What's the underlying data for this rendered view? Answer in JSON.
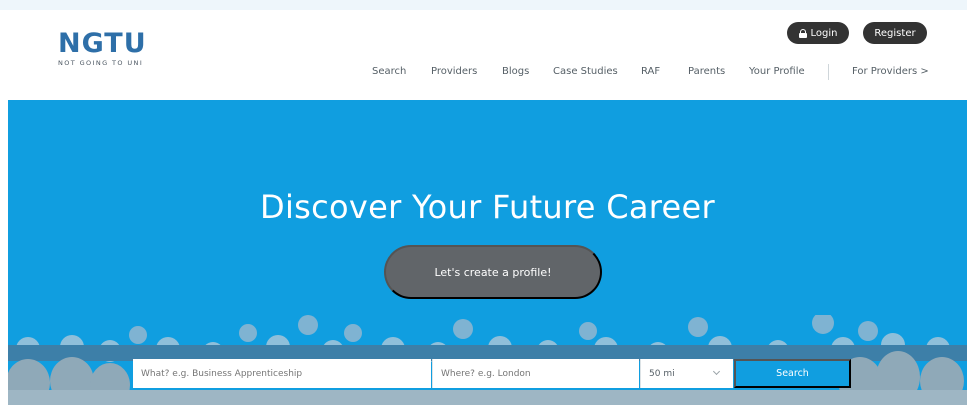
{
  "brand": {
    "logo_text": "NGTU",
    "tagline": "NOT GOING TO UNI",
    "logo_color": "#2e6fa8"
  },
  "auth": {
    "login_label": "Login",
    "register_label": "Register"
  },
  "nav": {
    "items": [
      "Search",
      "Providers",
      "Blogs",
      "Case Studies",
      "RAF",
      "Parents",
      "Your Profile"
    ],
    "providers_link": "For Providers >"
  },
  "hero": {
    "title": "Discover Your Future Career",
    "cta_label": "Let's create a profile!",
    "background_color": "#109ee0"
  },
  "search": {
    "what_placeholder": "What? e.g. Business Apprenticeship",
    "where_placeholder": "Where? e.g. London",
    "distance_value": "50 mi",
    "button_label": "Search"
  },
  "colors": {
    "accent": "#109ee0",
    "dark_button": "#333333",
    "cta_button": "#616569"
  },
  "icons": [
    "lock-icon",
    "chevron-down-icon"
  ]
}
